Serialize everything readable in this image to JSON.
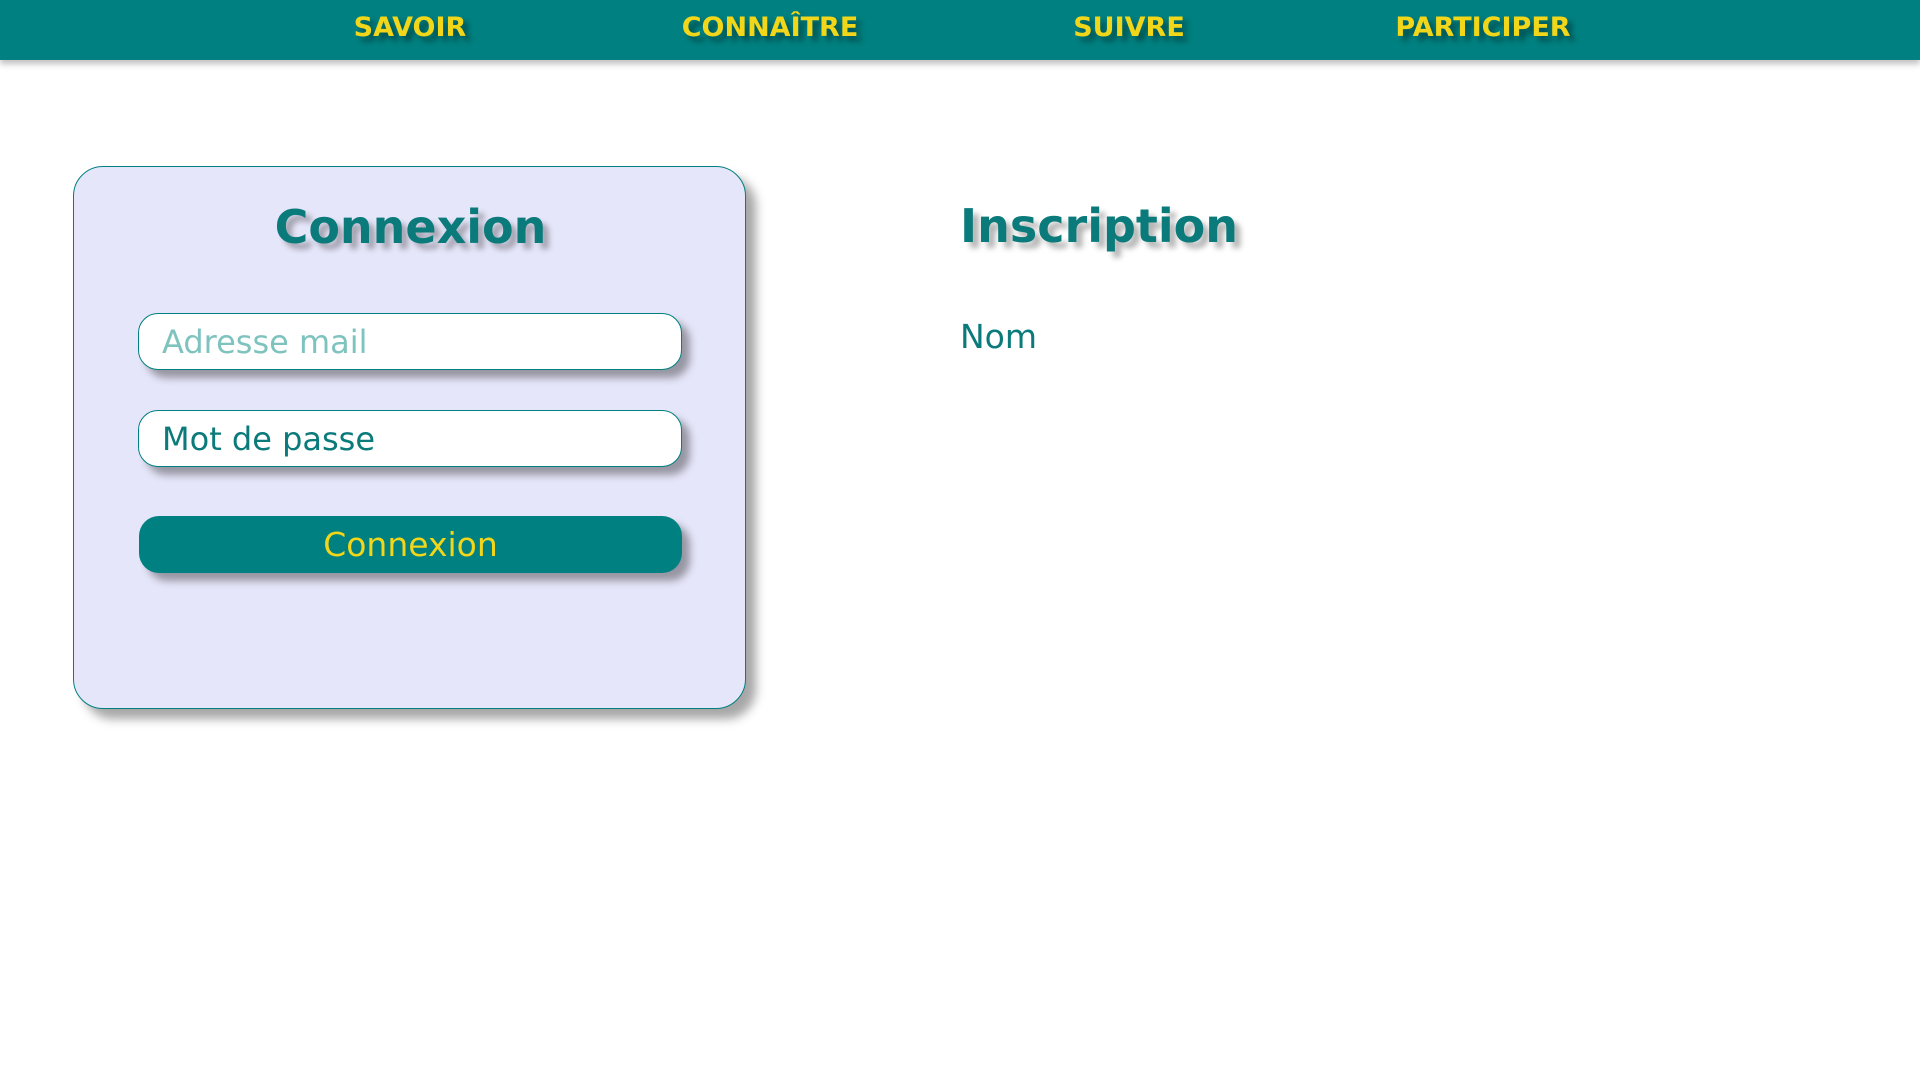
{
  "nav": {
    "items": [
      {
        "label": "SAVOIR"
      },
      {
        "label": "CONNAÎTRE"
      },
      {
        "label": "SUIVRE"
      },
      {
        "label": "PARTICIPER"
      }
    ]
  },
  "login": {
    "title": "Connexion",
    "email_placeholder": "Adresse mail",
    "email_value": "",
    "password_value": "Mot de passe",
    "submit_label": "Connexion"
  },
  "signup": {
    "title": "Inscription",
    "name_label": "Nom"
  },
  "colors": {
    "primary": "#008080",
    "accent": "#f2d619",
    "card_background": "#e6e6fa",
    "text": "#0a7a7a",
    "placeholder": "#7fc3bf"
  }
}
